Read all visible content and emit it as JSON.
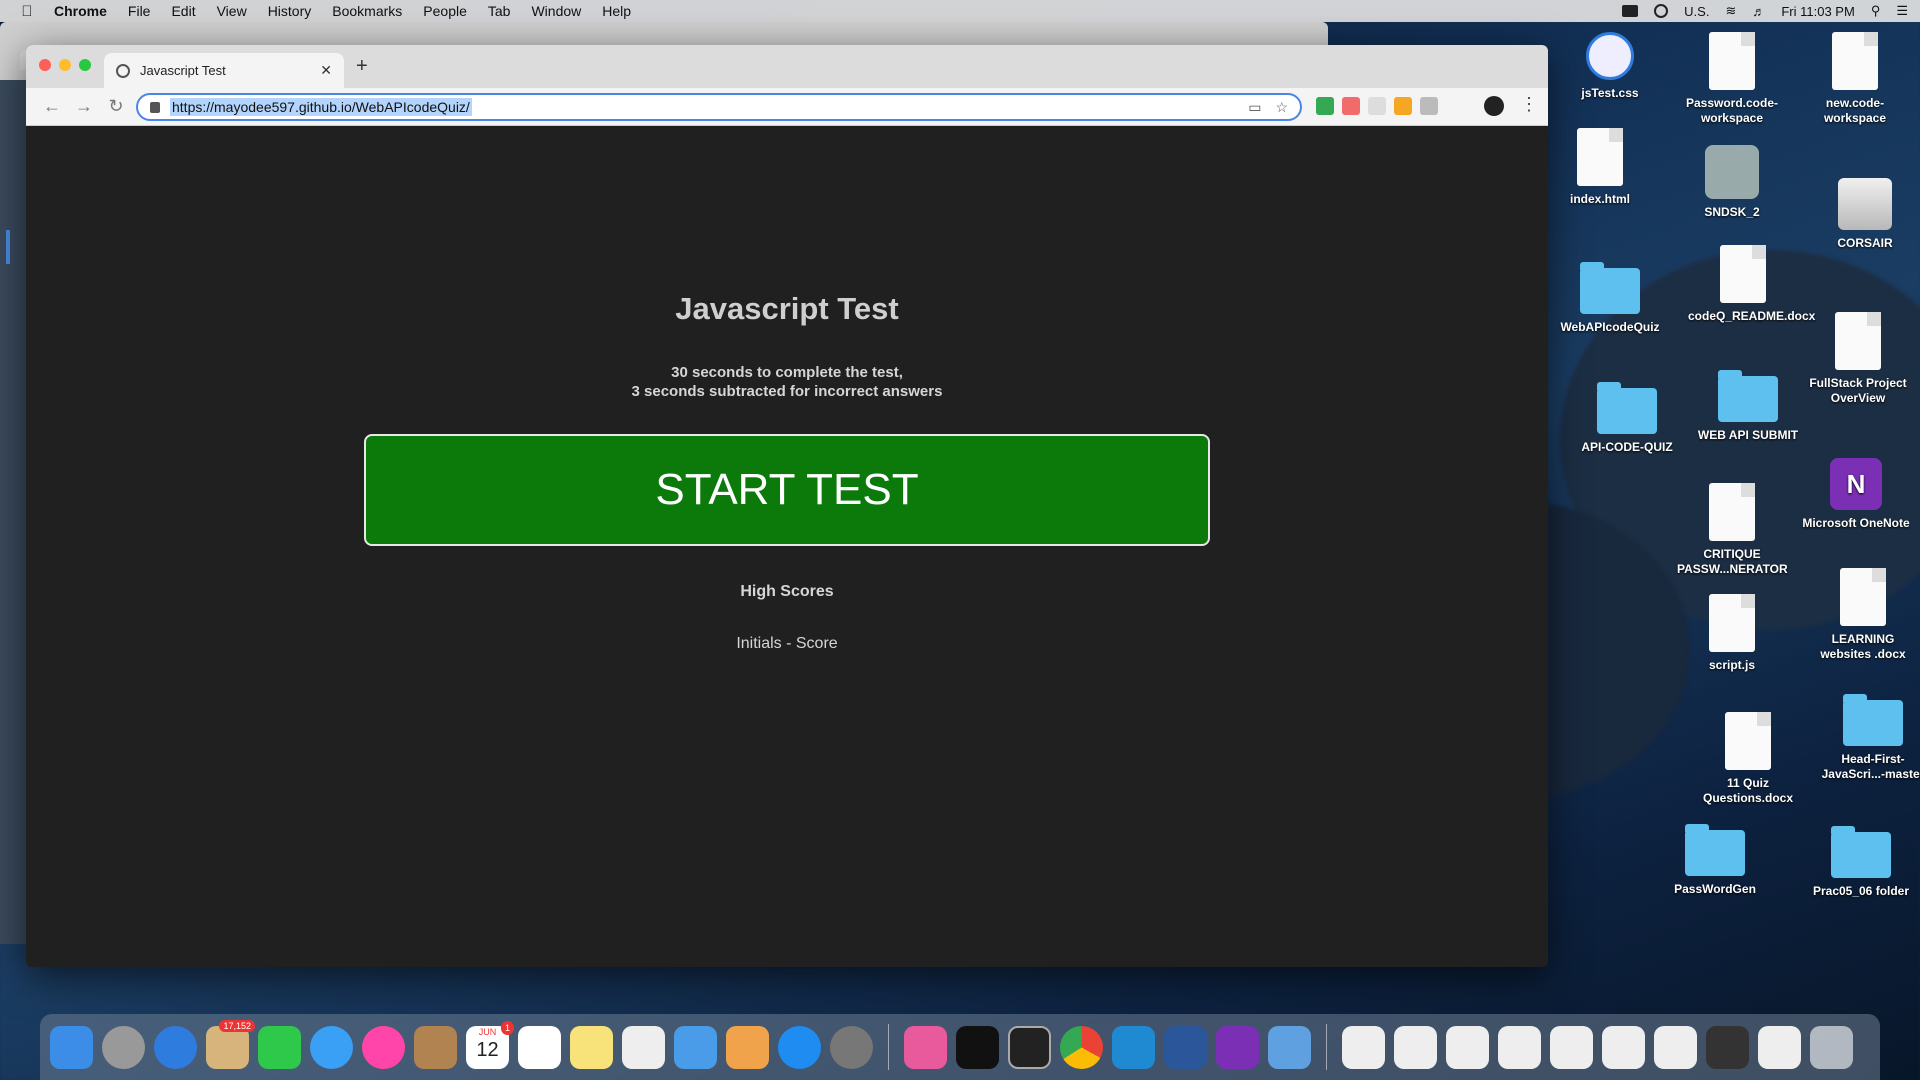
{
  "menubar": {
    "app": "Chrome",
    "items": [
      "File",
      "Edit",
      "View",
      "History",
      "Bookmarks",
      "People",
      "Tab",
      "Window",
      "Help"
    ],
    "input_source": "U.S.",
    "clock": "Fri 11:03 PM"
  },
  "browser": {
    "tab_title": "Javascript Test",
    "url": "https://mayodee597.github.io/WebAPIcodeQuiz/"
  },
  "page": {
    "title": "Javascript Test",
    "subtitle_line1": "30 seconds to complete the test,",
    "subtitle_line2": "3 seconds subtracted for incorrect answers",
    "start_button": "START TEST",
    "high_scores": "High Scores",
    "initials_score": "Initials - Score"
  },
  "desktop_icons": {
    "jstest": "jsTest.css",
    "password_ws": "Password.code-workspace",
    "new_ws": "new.code-workspace",
    "index": "index.html",
    "sndsk": "SNDSK_2",
    "corsair": "CORSAIR",
    "webapi": "WebAPIcodeQuiz",
    "codeq": "codeQ_README.docx",
    "fullstack": "FullStack Project OverView",
    "apicode": "API-CODE-QUIZ",
    "websubmit": "WEB API SUBMIT",
    "onenote": "Microsoft OneNote",
    "critique": "CRITIQUE PASSW...NERATOR",
    "learning": "LEARNING websites .docx",
    "script": "script.js",
    "quiz11": "11 Quiz Questions.docx",
    "headfirst": "Head-First-JavaScri...-master",
    "pwgen": "PassWordGen",
    "prac": "Prac05_06 folder"
  },
  "dock": {
    "mail_badge": "17,152",
    "calendar_month": "JUN",
    "calendar_day": "12",
    "calendar_badge": "1"
  }
}
